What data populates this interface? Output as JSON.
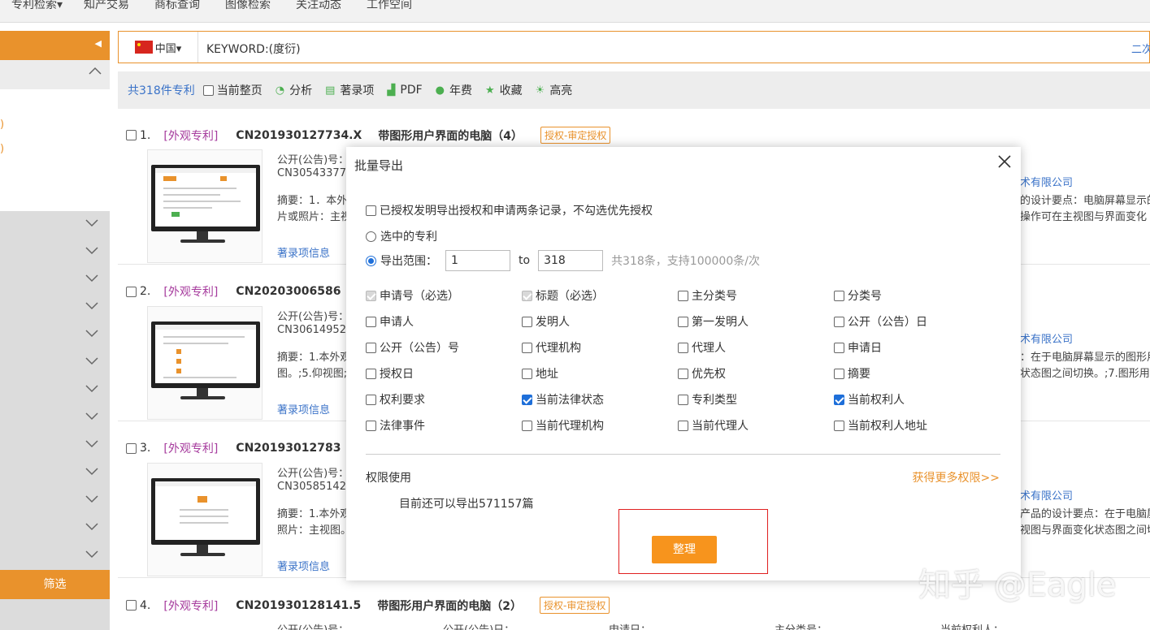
{
  "topnav": {
    "items": [
      "专利检索▾",
      "知产交易",
      "商标查询",
      "图像检索",
      "关注动态",
      "工作空间"
    ]
  },
  "sidebar": {
    "counts": [
      ")",
      ")"
    ],
    "filter_label": "筛选"
  },
  "search": {
    "country": "中国▾",
    "query": "KEYWORD:(度衍)",
    "second_search": "二次"
  },
  "toolbar": {
    "count": "共318件专利",
    "current_page": "当前整页",
    "analyze": "分析",
    "bib": "著录项",
    "pdf": "PDF",
    "annual_fee": "年费",
    "favorite": "收藏",
    "highlight": "高亮"
  },
  "records": [
    {
      "num": "1.",
      "type": "[外观专利]",
      "pno": "CN201930127734.X",
      "title": "带图形用户界面的电脑（4）",
      "badge": "授权-审定授权",
      "pub_label": "公开(公告)号：",
      "pub_no": "CN30543377",
      "abstract": "摘要：1．本外",
      "abstract2": "片或照片：主视",
      "link": "著录项信息",
      "company": "术有限公司",
      "desc1": "的设计要点：电脑屏幕显示的",
      "desc2": "操作可在主视图与界面变化"
    },
    {
      "num": "2.",
      "type": "[外观专利]",
      "pno": "CN20203006586",
      "title": "",
      "badge": "",
      "pub_label": "公开(公告)号：",
      "pub_no": "CN30614952",
      "abstract": "摘要：1.本外观",
      "abstract2": "图。;5.仰视图;",
      "link": "著录项信息",
      "company": "术有限公司",
      "desc1": "：在于电脑屏幕显示的图形用",
      "desc2": "状态图之间切换。;7.图形用户"
    },
    {
      "num": "3.",
      "type": "[外观专利]",
      "pno": "CN20193012783",
      "title": "",
      "badge": "",
      "pub_label": "公开(公告)号：",
      "pub_no": "CN30585142",
      "abstract": "摘要：1.本外观",
      "abstract2": "照片：主视图。",
      "link": "著录项信息",
      "company": "术有限公司",
      "desc1": "产品的设计要点：在于电脑屏",
      "desc2": "视图与界面变化状态图之间切"
    },
    {
      "num": "4.",
      "type": "[外观专利]",
      "pno": "CN201930128141.5",
      "title": "带图形用户界面的电脑（2）",
      "badge": "授权-审定授权",
      "meta": [
        "公开(公告)号：",
        "公开(公告)日：",
        "申请日：",
        "主分类号：",
        "当前权利人："
      ]
    }
  ],
  "modal": {
    "title": "批量导出",
    "option_both": "已授权发明导出授权和申请两条记录，不勾选优先授权",
    "selected": "选中的专利",
    "range_label": "导出范围：",
    "range_from": "1",
    "range_to_label": "to",
    "range_to": "318",
    "range_hint": "共318条，支持100000条/次",
    "fields": [
      {
        "label": "申请号（必选）",
        "state": "disabled"
      },
      {
        "label": "标题（必选）",
        "state": "disabled"
      },
      {
        "label": "主分类号",
        "state": "off"
      },
      {
        "label": "分类号",
        "state": "off"
      },
      {
        "label": "申请人",
        "state": "off"
      },
      {
        "label": "发明人",
        "state": "off"
      },
      {
        "label": "第一发明人",
        "state": "off"
      },
      {
        "label": "公开（公告）日",
        "state": "off"
      },
      {
        "label": "公开（公告）号",
        "state": "off"
      },
      {
        "label": "代理机构",
        "state": "off"
      },
      {
        "label": "代理人",
        "state": "off"
      },
      {
        "label": "申请日",
        "state": "off"
      },
      {
        "label": "授权日",
        "state": "off"
      },
      {
        "label": "地址",
        "state": "off"
      },
      {
        "label": "优先权",
        "state": "off"
      },
      {
        "label": "摘要",
        "state": "off"
      },
      {
        "label": "权利要求",
        "state": "off"
      },
      {
        "label": "当前法律状态",
        "state": "on"
      },
      {
        "label": "专利类型",
        "state": "off"
      },
      {
        "label": "当前权利人",
        "state": "on"
      },
      {
        "label": "法律事件",
        "state": "off"
      },
      {
        "label": "当前代理机构",
        "state": "off"
      },
      {
        "label": "当前代理人",
        "state": "off"
      },
      {
        "label": "当前权利人地址",
        "state": "off"
      }
    ],
    "perm_label": "权限使用",
    "more_perm": "获得更多权限>>",
    "remaining": "目前还可以导出571157篇",
    "ok_button": "整理"
  },
  "watermark": "知乎 @Eagle",
  "colors": {
    "accent": "#e9922c",
    "link": "#3b73c8",
    "checkbox": "#1e6fd9",
    "design_type": "#a63b9d"
  }
}
